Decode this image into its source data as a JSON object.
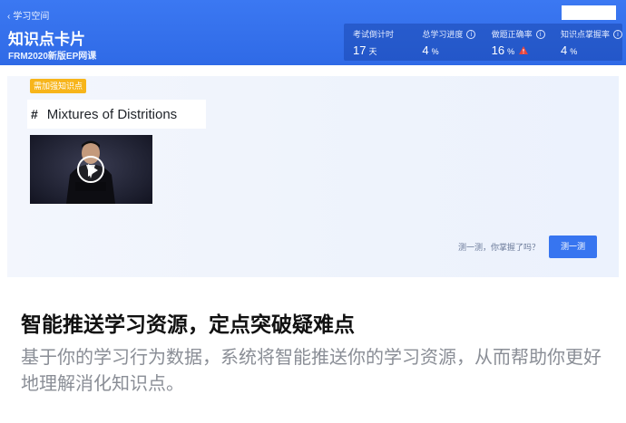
{
  "header": {
    "back_label": "学习空间",
    "title": "知识点卡片",
    "subtitle": "FRM2020新版EP网课"
  },
  "stats": [
    {
      "label": "考试倒计时",
      "value": "17",
      "unit": "天",
      "info_icon": false,
      "warning_icon": false
    },
    {
      "label": "总学习进度",
      "value": "4",
      "unit": "%",
      "info_icon": true,
      "warning_icon": false
    },
    {
      "label": "做题正确率",
      "value": "16",
      "unit": "%",
      "info_icon": true,
      "warning_icon": true
    },
    {
      "label": "知识点掌握率",
      "value": "4",
      "unit": "%",
      "info_icon": true,
      "warning_icon": false
    }
  ],
  "card": {
    "tag": "需加强知识点",
    "hash": "#",
    "title": "Mixtures of Distritions",
    "quiz_prompt": "测一测，你掌握了吗？",
    "quiz_button": "测一测"
  },
  "promo": {
    "headline": "智能推送学习资源，定点突破疑难点",
    "body": "基于你的学习行为数据，系统将智能推送你的学习资源，从而帮助你更好地理解消化知识点。"
  },
  "icons": {
    "back": "chevron-left-icon",
    "info": "info-icon",
    "warning": "warning-icon",
    "play": "play-icon"
  },
  "colors": {
    "header_blue": "#3272ec",
    "tag_yellow": "#f7b51b",
    "button_blue": "#3775f0",
    "warning_red": "#e8453c"
  }
}
